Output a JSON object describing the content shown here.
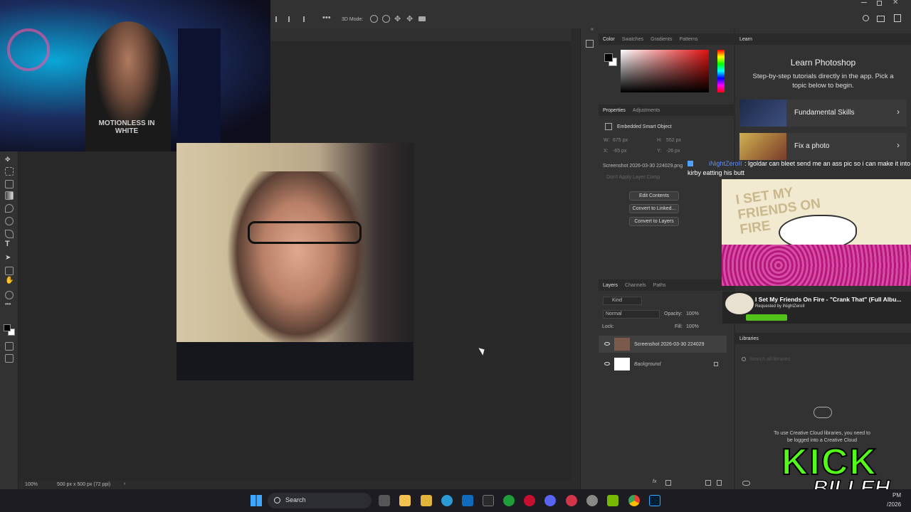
{
  "options_bar": {
    "mode_label": "3D Mode:"
  },
  "color_panel": {
    "tabs": [
      "Color",
      "Swatches",
      "Gradients",
      "Patterns"
    ]
  },
  "properties_panel": {
    "tabs": [
      "Properties",
      "Adjustments"
    ],
    "object_type": "Embedded Smart Object",
    "w_label": "W:",
    "w_value": "675 px",
    "h_label": "H:",
    "h_value": "552 px",
    "x_label": "X:",
    "x_value": "-65 px",
    "y_label": "Y:",
    "y_value": "-26 px",
    "file_name": "Screenshot 2026-03-30 224029.png",
    "layer_comp": "Don't Apply Layer Comp",
    "buttons": [
      "Edit Contents",
      "Convert to Linked...",
      "Convert to Layers"
    ]
  },
  "layers_panel": {
    "tabs": [
      "Layers",
      "Channels",
      "Paths"
    ],
    "kind_label": "Kind",
    "blend_mode": "Normal",
    "opacity_label": "Opacity:",
    "opacity_value": "100%",
    "lock_label": "Lock:",
    "fill_label": "Fill:",
    "fill_value": "100%",
    "layers": [
      {
        "name": "Screenshot 2026-03-30 224029"
      },
      {
        "name": "Background"
      }
    ]
  },
  "learn_panel": {
    "tab": "Learn",
    "title": "Learn Photoshop",
    "subtitle": "Step-by-step tutorials directly in the app. Pick a topic below to begin.",
    "cards": [
      "Fundamental Skills",
      "Fix a photo"
    ]
  },
  "libraries_panel": {
    "tab": "Libraries",
    "search_placeholder": "Search all libraries",
    "message": "To use Creative Cloud libraries, you need to be logged into a Creative Cloud"
  },
  "status_bar": {
    "zoom": "100%",
    "doc_info": "500 px x 500 px (72 ppi)"
  },
  "chat_overlay": {
    "user": "iNightZeroII",
    "message": ": lgoldar can bleet send me an ass pic so i can make it into",
    "message2": "kirby eatting his butt"
  },
  "now_playing": {
    "title": "I Set My Friends On Fire - \"Crank That\" (Full Albu...",
    "requested_by": "Requested by iNightZeroII",
    "album_text": "I SET MY FRIENDS ON FIRE"
  },
  "stream_logo": {
    "line1": "KICK",
    "line2": "BILLEH"
  },
  "taskbar": {
    "search_label": "Search",
    "clock_time": "PM",
    "clock_date": "/2026"
  },
  "webcam": {
    "shirt_text": "MOTIONLESS IN WHITE"
  },
  "colors": {
    "accent": "#2680eb",
    "panel": "#323232",
    "canvas": "#282828",
    "kick_green": "#53fc18"
  }
}
